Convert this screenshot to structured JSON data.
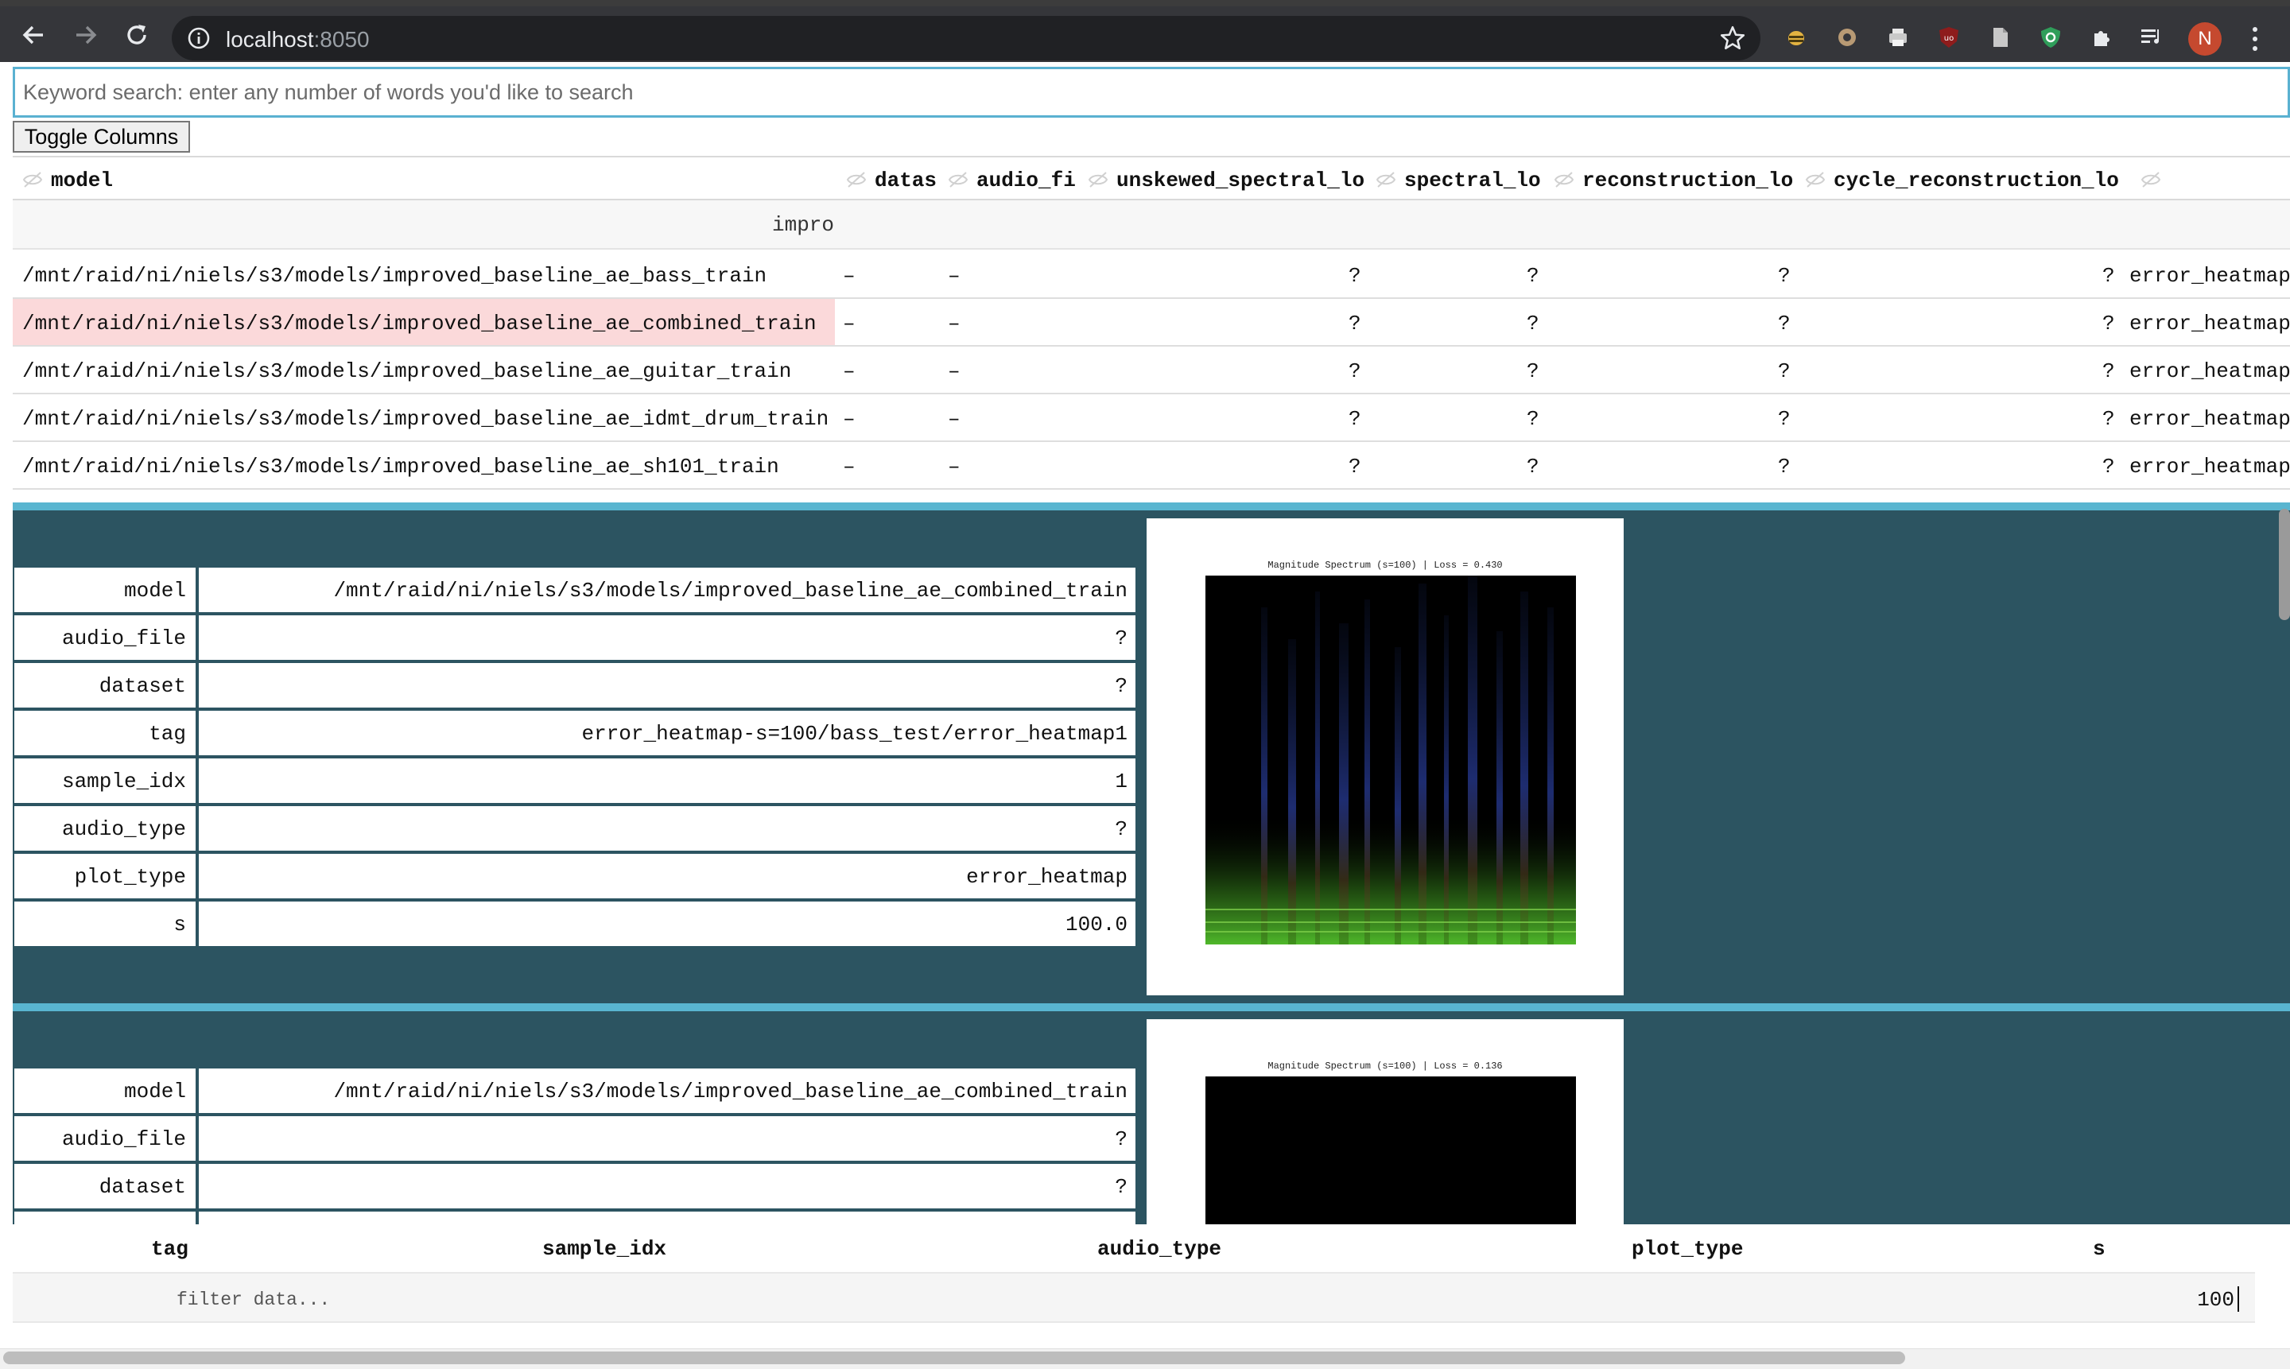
{
  "browser": {
    "url_host": "localhost",
    "url_port": ":8050",
    "profile_initial": "N"
  },
  "search": {
    "placeholder": "Keyword search: enter any number of words you'd like to search"
  },
  "toggle_columns_label": "Toggle Columns",
  "table": {
    "columns": [
      "model",
      "datas",
      "audio_fi",
      "unskewed_spectral_lo",
      "spectral_lo",
      "reconstruction_lo",
      "cycle_reconstruction_lo"
    ],
    "filter_value": "impro",
    "rows": [
      {
        "model": "/mnt/raid/ni/niels/s3/models/improved_baseline_ae_bass_train",
        "datas": "–",
        "audio_fi": "–",
        "unskewed": "?",
        "spectral": "?",
        "reconstruction": "?",
        "cycle": "?",
        "tag": "error_heatmap",
        "selected": false
      },
      {
        "model": "/mnt/raid/ni/niels/s3/models/improved_baseline_ae_combined_train",
        "datas": "–",
        "audio_fi": "–",
        "unskewed": "?",
        "spectral": "?",
        "reconstruction": "?",
        "cycle": "?",
        "tag": "error_heatmap",
        "selected": true
      },
      {
        "model": "/mnt/raid/ni/niels/s3/models/improved_baseline_ae_guitar_train",
        "datas": "–",
        "audio_fi": "–",
        "unskewed": "?",
        "spectral": "?",
        "reconstruction": "?",
        "cycle": "?",
        "tag": "error_heatmap",
        "selected": false
      },
      {
        "model": "/mnt/raid/ni/niels/s3/models/improved_baseline_ae_idmt_drum_train",
        "datas": "–",
        "audio_fi": "–",
        "unskewed": "?",
        "spectral": "?",
        "reconstruction": "?",
        "cycle": "?",
        "tag": "error_heatmap",
        "selected": false
      },
      {
        "model": "/mnt/raid/ni/niels/s3/models/improved_baseline_ae_sh101_train",
        "datas": "–",
        "audio_fi": "–",
        "unskewed": "?",
        "spectral": "?",
        "reconstruction": "?",
        "cycle": "?",
        "tag": "error_heatmap",
        "selected": false
      }
    ]
  },
  "panels": [
    {
      "fields": [
        {
          "key": "model",
          "value": "/mnt/raid/ni/niels/s3/models/improved_baseline_ae_combined_train"
        },
        {
          "key": "audio_file",
          "value": "?"
        },
        {
          "key": "dataset",
          "value": "?"
        },
        {
          "key": "tag",
          "value": "error_heatmap-s=100/bass_test/error_heatmap1"
        },
        {
          "key": "sample_idx",
          "value": "1"
        },
        {
          "key": "audio_type",
          "value": "?"
        },
        {
          "key": "plot_type",
          "value": "error_heatmap"
        },
        {
          "key": "s",
          "value": "100.0"
        }
      ],
      "plot_title": "Magnitude Spectrum (s=100) | Loss = 0.430"
    },
    {
      "fields": [
        {
          "key": "model",
          "value": "/mnt/raid/ni/niels/s3/models/improved_baseline_ae_combined_train"
        },
        {
          "key": "audio_file",
          "value": "?"
        },
        {
          "key": "dataset",
          "value": "?"
        }
      ],
      "plot_title": "Magnitude Spectrum (s=100) | Loss = 0.136"
    }
  ],
  "bottom_table": {
    "columns": [
      "tag",
      "sample_idx",
      "audio_type",
      "plot_type",
      "s"
    ],
    "filter_placeholder": "filter data...",
    "s_filter_value": "100"
  }
}
